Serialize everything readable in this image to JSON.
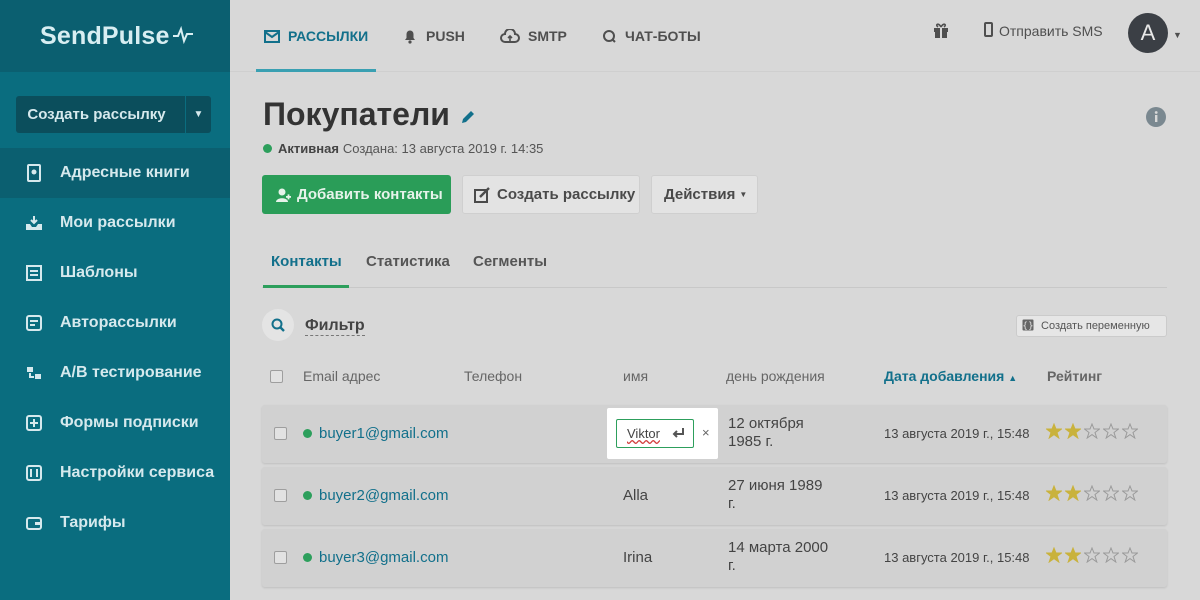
{
  "logo": {
    "text": "SendPulse"
  },
  "sidebar": {
    "create_label": "Создать рассылку",
    "items": [
      {
        "label": "Адресные книги",
        "icon": "address-book-icon"
      },
      {
        "label": "Мои рассылки",
        "icon": "inbox-icon"
      },
      {
        "label": "Шаблоны",
        "icon": "template-icon"
      },
      {
        "label": "Авторассылки",
        "icon": "automation-icon"
      },
      {
        "label": "A/B тестирование",
        "icon": "ab-test-icon"
      },
      {
        "label": "Формы подписки",
        "icon": "form-icon"
      },
      {
        "label": "Настройки сервиса",
        "icon": "settings-icon"
      },
      {
        "label": "Тарифы",
        "icon": "wallet-icon"
      }
    ]
  },
  "topbar": {
    "tabs": [
      {
        "label": "РАССЫЛКИ",
        "icon": "mail-icon",
        "active": true
      },
      {
        "label": "PUSH",
        "icon": "bell-icon"
      },
      {
        "label": "SMTP",
        "icon": "cloud-upload-icon"
      },
      {
        "label": "ЧАТ-БОТЫ",
        "icon": "chat-icon"
      }
    ],
    "sms_label": "Отправить SMS",
    "avatar_letter": "A"
  },
  "page": {
    "title": "Покупатели",
    "status": "Активная",
    "created": "Создана: 13 августа 2019 г. 14:35"
  },
  "actions": {
    "add_contacts": "Добавить контакты",
    "create_campaign": "Создать рассылку",
    "actions": "Действия"
  },
  "tabs": [
    {
      "label": "Контакты",
      "active": true
    },
    {
      "label": "Статистика"
    },
    {
      "label": "Сегменты"
    }
  ],
  "filter": {
    "label": "Фильтр",
    "create_variable": "Создать переменную"
  },
  "table": {
    "headers": {
      "email": "Email адрес",
      "phone": "Телефон",
      "name": "имя",
      "birthday": "день рождения",
      "added": "Дата добавления",
      "rating": "Рейтинг"
    },
    "rows": [
      {
        "email": "buyer1@gmail.com",
        "phone": "",
        "name": "Viktor",
        "birthday_line1": "12 октября",
        "birthday_line2": "1985 г.",
        "added": "13 августа 2019 г., 15:48",
        "rating": 2
      },
      {
        "email": "buyer2@gmail.com",
        "phone": "",
        "name": "Alla",
        "birthday_line1": "27 июня 1989",
        "birthday_line2": "г.",
        "added": "13 августа 2019 г., 15:48",
        "rating": 2
      },
      {
        "email": "buyer3@gmail.com",
        "phone": "",
        "name": "Irina",
        "birthday_line1": "14 марта 2000",
        "birthday_line2": "г.",
        "added": "13 августа 2019 г., 15:48",
        "rating": 2
      }
    ]
  },
  "edit_field": {
    "value": "Viktor",
    "close": "×"
  },
  "colors": {
    "sidebar": "#0a6d7f",
    "accent_green": "#2a9d58",
    "link": "#12708b",
    "star": "#c9b23c"
  }
}
